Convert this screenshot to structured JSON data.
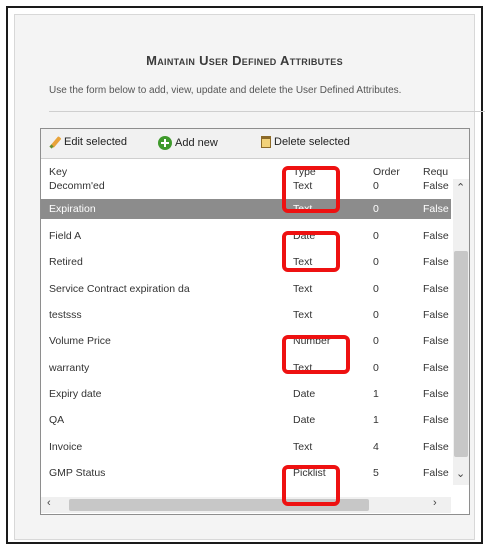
{
  "page": {
    "title": "Maintain User Defined Attributes",
    "description": "Use the form below to add, view, update and delete the User Defined Attributes."
  },
  "toolbar": {
    "edit_label": "Edit selected",
    "add_label": "Add new",
    "delete_label": "Delete selected"
  },
  "grid": {
    "columns": [
      "Key",
      "Type",
      "Order",
      "Requ"
    ],
    "rows": [
      {
        "key": "Decomm'ed",
        "type": "Text",
        "order": "0",
        "required": "False"
      },
      {
        "key": "Expiration",
        "type": "Text",
        "order": "0",
        "required": "False"
      },
      {
        "key": "Field A",
        "type": "Date",
        "order": "0",
        "required": "False"
      },
      {
        "key": "Retired",
        "type": "Text",
        "order": "0",
        "required": "False"
      },
      {
        "key": "Service Contract expiration da",
        "type": "Text",
        "order": "0",
        "required": "False"
      },
      {
        "key": "testsss",
        "type": "Text",
        "order": "0",
        "required": "False"
      },
      {
        "key": "Volume Price",
        "type": "Number",
        "order": "0",
        "required": "False"
      },
      {
        "key": "warranty",
        "type": "Text",
        "order": "0",
        "required": "False"
      },
      {
        "key": "Expiry date",
        "type": "Date",
        "order": "1",
        "required": "False"
      },
      {
        "key": "QA",
        "type": "Date",
        "order": "1",
        "required": "False"
      },
      {
        "key": "Invoice",
        "type": "Text",
        "order": "4",
        "required": "False"
      },
      {
        "key": "GMP Status",
        "type": "Picklist",
        "order": "5",
        "required": "False"
      }
    ],
    "selected_row": "Expiration"
  },
  "colors": {
    "selection": "#8c8c8c",
    "highlight": "#ee1111",
    "add_icon": "#3f9a2c"
  }
}
